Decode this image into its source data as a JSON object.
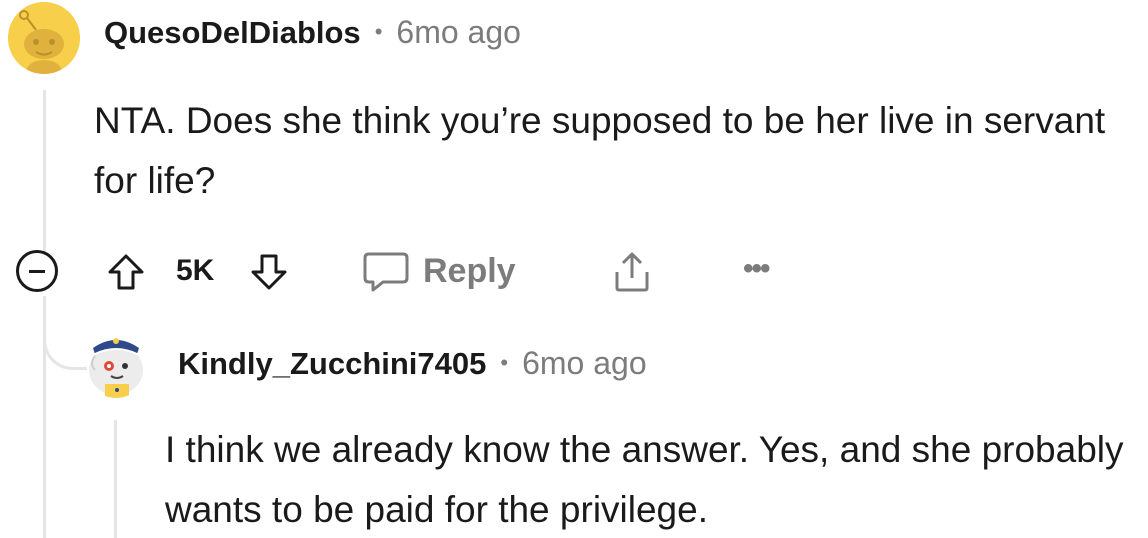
{
  "comments": [
    {
      "username": "QuesoDelDiablos",
      "separator": "•",
      "time": "6mo ago",
      "body": "NTA. Does she think you’re supposed to be her live in servant for life?",
      "avatar_color": "#f7cf4a",
      "actions": {
        "vote_count": "5K",
        "reply_label": "Reply",
        "icons": [
          "collapse-icon",
          "upvote-icon",
          "downvote-icon",
          "reply-icon",
          "share-icon",
          "more-icon"
        ]
      }
    },
    {
      "username": "Kindly_Zucchini7405",
      "separator": "•",
      "time": "6mo ago",
      "body": "I think we already know the answer. Yes, and she probably wants to be paid for the privilege.",
      "avatar_color": "#9aa6b8"
    }
  ],
  "more_label": "•••"
}
